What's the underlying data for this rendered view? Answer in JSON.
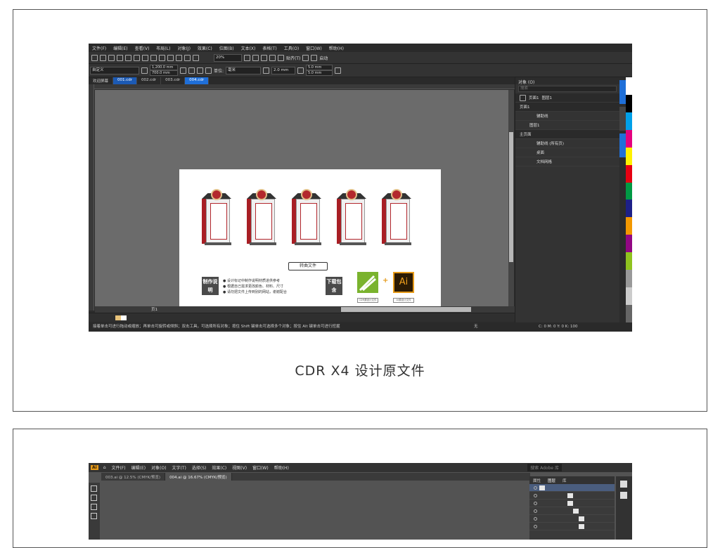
{
  "caption": "CDR X4 设计原文件",
  "cdr": {
    "menu": [
      "文件(F)",
      "编辑(E)",
      "查看(V)",
      "布局(L)",
      "对象(J)",
      "效果(C)",
      "位图(B)",
      "文本(X)",
      "表格(T)",
      "工具(O)",
      "窗口(W)",
      "帮助(H)"
    ],
    "toolbar": {
      "zoom": "20%",
      "snap_label": "贴齐(T)",
      "launch_label": "启动"
    },
    "property_bar": {
      "preset": "自定义",
      "width": "1,200.0 mm",
      "height": "700.0 mm",
      "units_label": "单位:",
      "units_value": "毫米",
      "nudge": "2.0 mm",
      "dup_x": "5.0 mm",
      "dup_y": "5.0 mm"
    },
    "tabs": [
      "欢迎屏幕",
      "001.cdr",
      "002.cdr",
      "003.cdr",
      "004.cdr"
    ],
    "page_tab": "页1",
    "status_text": "接着单击可进行拖动或缩放；再单击可旋转或倾斜；双击工具，可选择所有对象；按住 Shift 键单击可选择多个对象；按住 Alt 键单击可进行挖掘",
    "status_fill": "无",
    "status_color": "C: 0 M: 0 Y: 0 K: 100",
    "artwork": {
      "file_button": "转曲文件",
      "badge_make": "制作说明",
      "badge_download": "下载包含",
      "notes": [
        "● 设计标记中制作说明材质进供参考",
        "● 根据自己需求更改颜色、材料、尺寸",
        "● 请勿把文件上传到别的网站，谢谢配合"
      ],
      "ai_logo": "Ai",
      "plus": "+",
      "cdr_file_label": "CDR源设计文件",
      "ai_file_label": "AI源设计文件"
    }
  },
  "objects_panel": {
    "title": "对象 (O)",
    "search": "搜索",
    "header": "页面1",
    "layer_header": "图层1",
    "rows": [
      {
        "label": "页面1",
        "head": true
      },
      {
        "label": "辅助线",
        "head": false
      },
      {
        "label": "图层1",
        "head": false
      },
      {
        "label": "主页面",
        "head": true
      },
      {
        "label": "辅助线 (所有页)",
        "head": false
      },
      {
        "label": "桌面",
        "head": false
      },
      {
        "label": "文档网格",
        "head": false
      }
    ]
  },
  "ai": {
    "menu": [
      "文件(F)",
      "编辑(E)",
      "对象(O)",
      "文字(T)",
      "选择(S)",
      "效果(C)",
      "视图(V)",
      "窗口(W)",
      "帮助(H)"
    ],
    "tabs": [
      "003.ai @ 12.5% (CMYK/预览)",
      "004.ai @ 16.67% (CMYK/预览)"
    ],
    "search_placeholder": "搜索 Adobe 库",
    "panel_tabs": [
      "属性",
      "图层",
      "库"
    ]
  },
  "colors": {
    "accent": "#1f6fd8",
    "sign_red": "#b3272d",
    "cdr_green": "#7ab32e",
    "ai_orange": "#e69a19"
  }
}
